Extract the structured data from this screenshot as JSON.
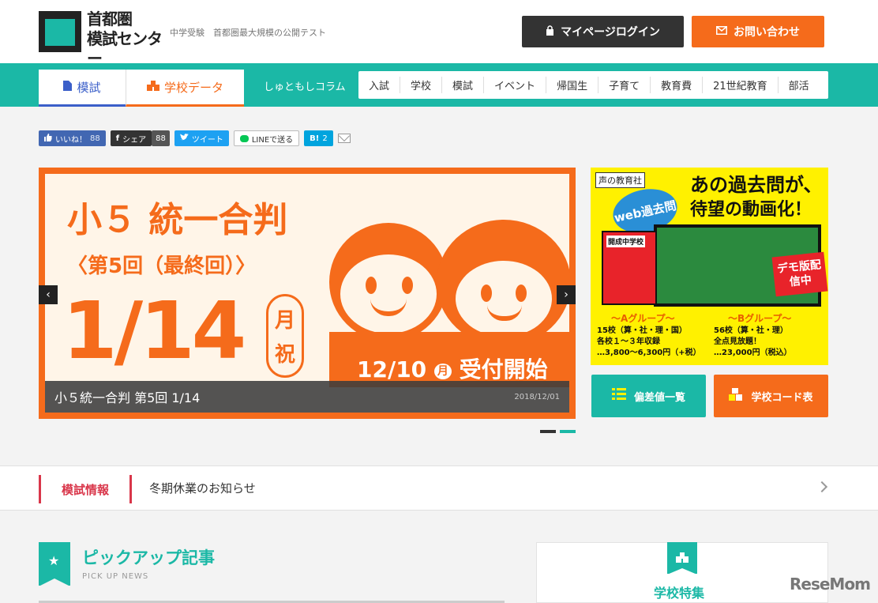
{
  "header": {
    "logo_line1": "首都圏",
    "logo_line2": "模試センター",
    "tagline": "中学受験　首都圏最大規模の公開テスト",
    "login_label": "マイページログイン",
    "contact_label": "お問い合わせ"
  },
  "nav": {
    "tab_moshi": "模試",
    "tab_school": "学校データ",
    "column_label": "しゅともしコラム",
    "column_items": [
      "入試",
      "学校",
      "模試",
      "イベント",
      "帰国生",
      "子育て",
      "教育費",
      "21世紀教育",
      "部活"
    ]
  },
  "social": {
    "like": "いいね！",
    "like_count": "88",
    "share": "シェア",
    "share_count": "88",
    "tweet": "ツイート",
    "line": "LINEで送る",
    "hatena": "B!",
    "hatena_count": "2"
  },
  "hero": {
    "title": "小５ 統一合判",
    "subtitle": "〈第5回（最終回）〉",
    "date": "1/14",
    "day1": "月",
    "day2": "祝",
    "reception": "12/10",
    "reception_day": "月",
    "reception_text": "受付開始",
    "caption_title": "小５統一合判 第5回 1/14",
    "caption_date": "2018/12/01",
    "prev": "‹",
    "next": "›"
  },
  "ad": {
    "publisher": "声の教育社",
    "web_badge": "web過去問",
    "headline1": "あの過去問が、",
    "headline2": "待望の動画化！",
    "book_label": "開成中学校",
    "demo": "デモ版配信中",
    "group_a": "～Aグループ～",
    "group_a_l1": "15校（算・社・理・国）",
    "group_a_l2": "各校１～３年収録",
    "group_a_l3": "…3,800～6,300円（+税）",
    "group_b": "～Bグループ～",
    "group_b_l1": "56校（算・社・理）",
    "group_b_l2": "全点見放題！",
    "group_b_l3": "…23,000円（税込）"
  },
  "quick": {
    "hensachi": "偏差値一覧",
    "school_code": "学校コード表"
  },
  "news": {
    "label": "模試情報",
    "text": "冬期休業のお知らせ"
  },
  "pickup": {
    "title": "ピックアップ記事",
    "subtitle": "PICK UP NEWS"
  },
  "feature": {
    "title": "学校特集"
  },
  "watermark": "ReseMom",
  "colors": {
    "teal": "#1bb8a6",
    "orange": "#f56b1b",
    "dark": "#333333",
    "red": "#d9364a",
    "blue": "#3b5fc9"
  }
}
